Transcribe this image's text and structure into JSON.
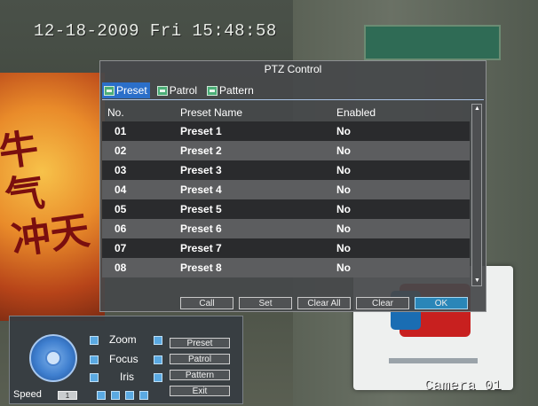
{
  "overlay": {
    "timestamp": "12-18-2009 Fri 15:48:58",
    "camera_label": "Camera 01"
  },
  "dialog": {
    "title": "PTZ Control",
    "tabs": [
      {
        "label": "Preset",
        "active": true,
        "icon": "tab-icon"
      },
      {
        "label": "Patrol",
        "active": false,
        "icon": "tab-icon"
      },
      {
        "label": "Pattern",
        "active": false,
        "icon": "tab-icon"
      }
    ],
    "columns": {
      "no": "No.",
      "name": "Preset Name",
      "enabled": "Enabled"
    },
    "rows": [
      {
        "no": "01",
        "name": "Preset 1",
        "enabled": "No"
      },
      {
        "no": "02",
        "name": "Preset 2",
        "enabled": "No"
      },
      {
        "no": "03",
        "name": "Preset 3",
        "enabled": "No"
      },
      {
        "no": "04",
        "name": "Preset 4",
        "enabled": "No"
      },
      {
        "no": "05",
        "name": "Preset 5",
        "enabled": "No"
      },
      {
        "no": "06",
        "name": "Preset 6",
        "enabled": "No"
      },
      {
        "no": "07",
        "name": "Preset 7",
        "enabled": "No"
      },
      {
        "no": "08",
        "name": "Preset 8",
        "enabled": "No"
      }
    ],
    "buttons": {
      "call": "Call",
      "set": "Set",
      "clear_all": "Clear All",
      "clear": "Clear",
      "ok": "OK"
    }
  },
  "panel": {
    "zoom_label": "Zoom",
    "focus_label": "Focus",
    "iris_label": "Iris",
    "preset_button": "Preset",
    "patrol_button": "Patrol",
    "pattern_button": "Pattern",
    "exit_button": "Exit",
    "speed_label": "Speed",
    "speed_value": "1"
  },
  "colors": {
    "tab_active": "#2b6fc9",
    "ok_button": "#2a86b8",
    "dpad": "#3f7fcf"
  }
}
